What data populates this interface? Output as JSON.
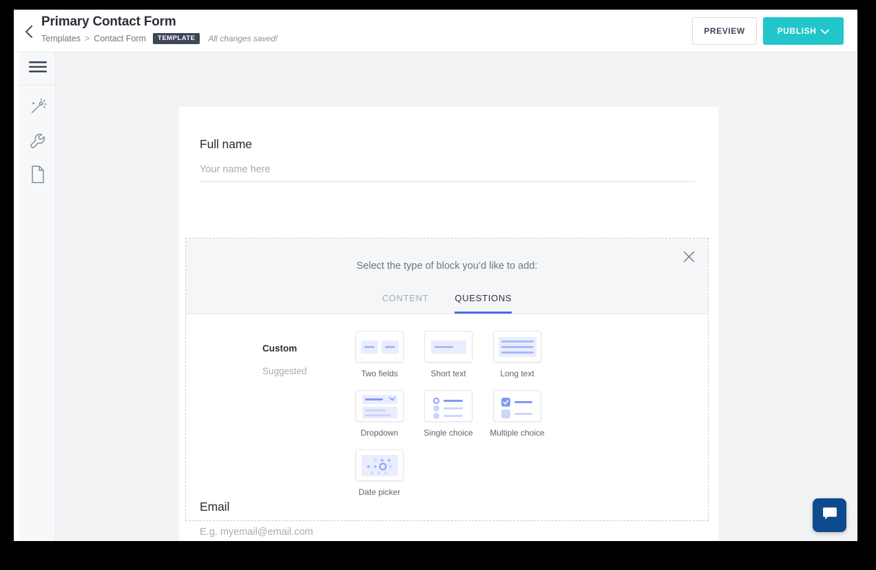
{
  "header": {
    "back_icon": "chevron-left-icon",
    "title": "Primary Contact Form",
    "breadcrumb": {
      "root": "Templates",
      "separator": ">",
      "current": "Contact Form"
    },
    "badge": "TEMPLATE",
    "save_status": "All changes saved!",
    "preview_label": "PREVIEW",
    "publish_label": "PUBLISH",
    "publish_chevron_icon": "chevron-down-icon",
    "publish_color": "#22c6ca",
    "badge_color": "#3d4658"
  },
  "sidebar": {
    "menu_icon": "hamburger-menu-icon",
    "items": [
      {
        "icon": "magic-wand-icon",
        "name": "design"
      },
      {
        "icon": "wrench-icon",
        "name": "settings"
      },
      {
        "icon": "document-icon",
        "name": "pages"
      }
    ]
  },
  "form": {
    "fields": [
      {
        "label": "Full name",
        "placeholder": "Your name here",
        "value": ""
      },
      {
        "label": "Email",
        "placeholder": "E.g. myemail@email.com",
        "value": ""
      }
    ]
  },
  "picker": {
    "prompt": "Select the type of block you’d like to add:",
    "close_icon": "close-icon",
    "tabs": [
      {
        "label": "CONTENT",
        "active": false
      },
      {
        "label": "QUESTIONS",
        "active": true
      }
    ],
    "active_tab_color": "#4a69e8",
    "categories": [
      {
        "label": "Custom",
        "active": true
      },
      {
        "label": "Suggested",
        "active": false
      }
    ],
    "blocks": [
      {
        "label": "Two fields",
        "icon": "two-fields-icon"
      },
      {
        "label": "Short text",
        "icon": "short-text-icon"
      },
      {
        "label": "Long text",
        "icon": "long-text-icon"
      },
      {
        "label": "Dropdown",
        "icon": "dropdown-icon"
      },
      {
        "label": "Single choice",
        "icon": "single-choice-icon"
      },
      {
        "label": "Multiple choice",
        "icon": "multiple-choice-icon"
      },
      {
        "label": "Date picker",
        "icon": "date-picker-icon"
      }
    ]
  },
  "chat": {
    "icon": "chat-bubble-icon",
    "color": "#0e4a8e"
  }
}
